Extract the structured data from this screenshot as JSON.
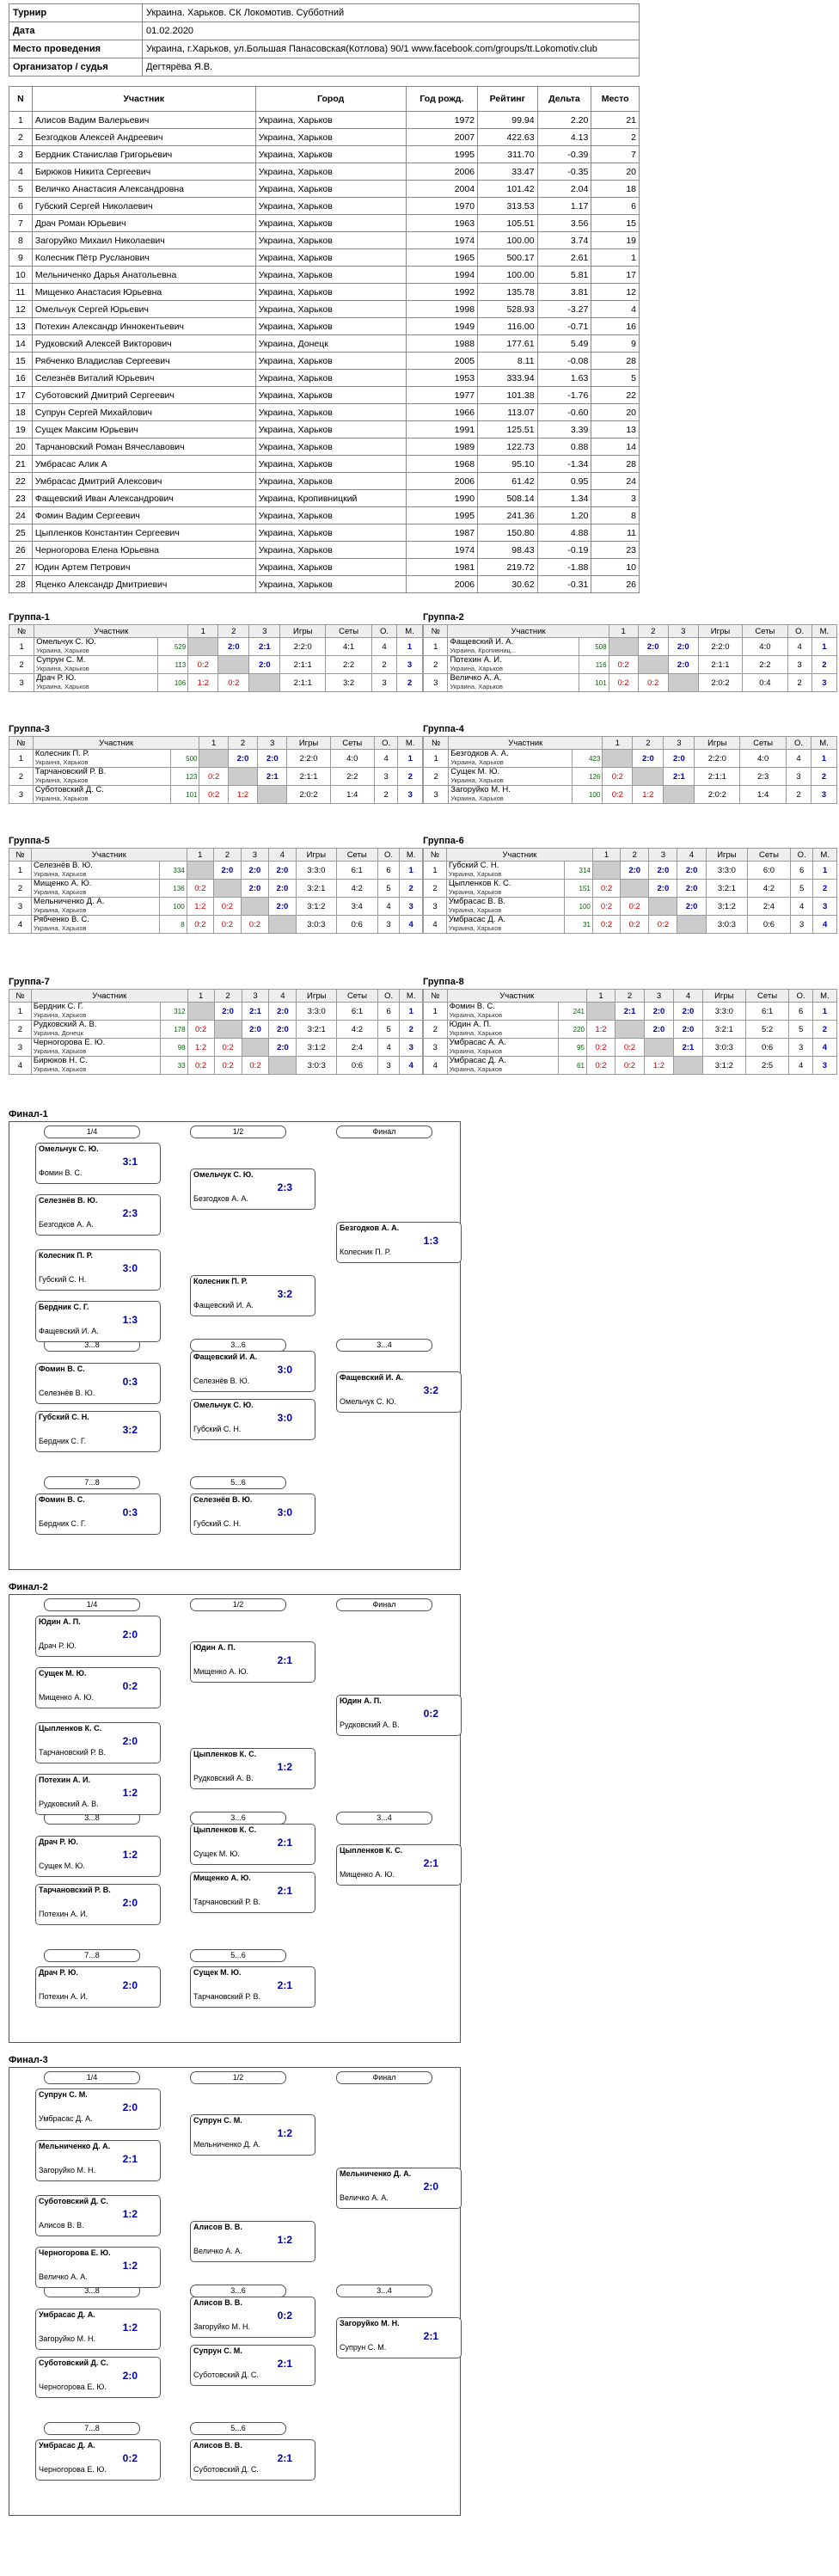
{
  "info": [
    {
      "label": "Турнир",
      "value": "Украина. Харьков. СК Локомотив. Субботний"
    },
    {
      "label": "Дата",
      "value": "01.02.2020"
    },
    {
      "label": "Место проведения",
      "value": "Украина, г.Харьков, ул.Большая Панасовская(Котлова) 90/1 www.facebook.com/groups/tt.Lokomotiv.club"
    },
    {
      "label": "Организатор / судья",
      "value": "Дегтярёва Я.В."
    }
  ],
  "players_header": [
    "N",
    "Участник",
    "Город",
    "Год рожд.",
    "Рейтинг",
    "Дельта",
    "Место"
  ],
  "players": [
    [
      "1",
      "Алисов Вадим Валерьевич",
      "Украина, Харьков",
      "1972",
      "99.94",
      "2.20",
      "21"
    ],
    [
      "2",
      "Безгодков Алексей Андреевич",
      "Украина, Харьков",
      "2007",
      "422.63",
      "4.13",
      "2"
    ],
    [
      "3",
      "Бердник Станислав Григорьевич",
      "Украина, Харьков",
      "1995",
      "311.70",
      "-0.39",
      "7"
    ],
    [
      "4",
      "Бирюков Никита Сергеевич",
      "Украина, Харьков",
      "2006",
      "33.47",
      "-0.35",
      "20"
    ],
    [
      "5",
      "Величко Анастасия Александровна",
      "Украина, Харьков",
      "2004",
      "101.42",
      "2.04",
      "18"
    ],
    [
      "6",
      "Губский Сергей Николаевич",
      "Украина, Харьков",
      "1970",
      "313.53",
      "1.17",
      "6"
    ],
    [
      "7",
      "Драч Роман Юрьевич",
      "Украина, Харьков",
      "1963",
      "105.51",
      "3.56",
      "15"
    ],
    [
      "8",
      "Загоруйко Михаил Николаевич",
      "Украина, Харьков",
      "1974",
      "100.00",
      "3.74",
      "19"
    ],
    [
      "9",
      "Колесник Пётр Русланович",
      "Украина, Харьков",
      "1965",
      "500.17",
      "2.61",
      "1"
    ],
    [
      "10",
      "Мельниченко Дарья Анатольевна",
      "Украина, Харьков",
      "1994",
      "100.00",
      "5.81",
      "17"
    ],
    [
      "11",
      "Мищенко Анастасия Юрьевна",
      "Украина, Харьков",
      "1992",
      "135.78",
      "3.81",
      "12"
    ],
    [
      "12",
      "Омельчук Сергей Юрьевич",
      "Украина, Харьков",
      "1998",
      "528.93",
      "-3.27",
      "4"
    ],
    [
      "13",
      "Потехин Александр Иннокентьевич",
      "Украина, Харьков",
      "1949",
      "116.00",
      "-0.71",
      "16"
    ],
    [
      "14",
      "Рудковский Алексей Викторович",
      "Украина, Донецк",
      "1988",
      "177.61",
      "5.49",
      "9"
    ],
    [
      "15",
      "Рябченко Владислав Сергеевич",
      "Украина, Харьков",
      "2005",
      "8.11",
      "-0.08",
      "28"
    ],
    [
      "16",
      "Селезнёв Виталий Юрьевич",
      "Украина, Харьков",
      "1953",
      "333.94",
      "1.63",
      "5"
    ],
    [
      "17",
      "Суботовский Дмитрий Сергеевич",
      "Украина, Харьков",
      "1977",
      "101.38",
      "-1.76",
      "22"
    ],
    [
      "18",
      "Супрун Сергей Михайлович",
      "Украина, Харьков",
      "1966",
      "113.07",
      "-0.60",
      "20"
    ],
    [
      "19",
      "Сущек Максим Юрьевич",
      "Украина, Харьков",
      "1991",
      "125.51",
      "3.39",
      "13"
    ],
    [
      "20",
      "Тарчановский Роман Вячеславович",
      "Украина, Харьков",
      "1989",
      "122.73",
      "0.88",
      "14"
    ],
    [
      "21",
      "Умбрасас Алик А",
      "Украина, Харьков",
      "1968",
      "95.10",
      "-1.34",
      "28"
    ],
    [
      "22",
      "Умбрасас Дмитрий Алексович",
      "Украина, Харьков",
      "2006",
      "61.42",
      "0.95",
      "24"
    ],
    [
      "23",
      "Фащевский Иван Александрович",
      "Украина, Кропивницкий",
      "1990",
      "508.14",
      "1.34",
      "3"
    ],
    [
      "24",
      "Фомин Вадим Сергеевич",
      "Украина, Харьков",
      "1995",
      "241.36",
      "1.20",
      "8"
    ],
    [
      "25",
      "Цыпленков Константин Сергеевич",
      "Украина, Харьков",
      "1987",
      "150.80",
      "4.88",
      "11"
    ],
    [
      "26",
      "Черногорова Елена Юрьевна",
      "Украина, Харьков",
      "1974",
      "98.43",
      "-0.19",
      "23"
    ],
    [
      "27",
      "Юдин Артем Петрович",
      "Украина, Харьков",
      "1981",
      "219.72",
      "-1.88",
      "10"
    ],
    [
      "28",
      "Яценко Александр Дмитриевич",
      "Украина, Харьков",
      "2006",
      "30.62",
      "-0.31",
      "26"
    ]
  ],
  "groups": [
    {
      "title": "Группа-1",
      "rows": [
        [
          "1",
          "Омельчук С. Ю.",
          "Украина, Харьков",
          "529",
          "",
          "2:0",
          "2:1",
          "2:2:0",
          "4:1",
          "4",
          "1"
        ],
        [
          "2",
          "Супрун С. М.",
          "Украина, Харьков",
          "113",
          "0:2",
          "",
          "2:0",
          "2:1:1",
          "2:2",
          "2",
          "3"
        ],
        [
          "3",
          "Драч Р. Ю.",
          "Украина, Харьков",
          "106",
          "1:2",
          "0:2",
          "",
          "2:1:1",
          "3:2",
          "3",
          "2"
        ]
      ]
    },
    {
      "title": "Группа-2",
      "rows": [
        [
          "1",
          "Фащевский И. А.",
          "Украина, Кропивниц...",
          "508",
          "",
          "2:0",
          "2:0",
          "2:2:0",
          "4:0",
          "4",
          "1"
        ],
        [
          "2",
          "Потехин А. И.",
          "Украина, Харьков",
          "116",
          "0:2",
          "",
          "2:0",
          "2:1:1",
          "2:2",
          "3",
          "2"
        ],
        [
          "3",
          "Величко А. А.",
          "Украина, Харьков",
          "101",
          "0:2",
          "0:2",
          "",
          "2:0:2",
          "0:4",
          "2",
          "3"
        ]
      ]
    },
    {
      "title": "Группа-3",
      "rows": [
        [
          "1",
          "Колесник П. Р.",
          "Украина, Харьков",
          "500",
          "",
          "2:0",
          "2:0",
          "2:2:0",
          "4:0",
          "4",
          "1"
        ],
        [
          "2",
          "Тарчановский Р. В.",
          "Украина, Харьков",
          "123",
          "0:2",
          "",
          "2:1",
          "2:1:1",
          "2:2",
          "3",
          "2"
        ],
        [
          "3",
          "Суботовский Д. С.",
          "Украина, Харьков",
          "101",
          "0:2",
          "1:2",
          "",
          "2:0:2",
          "1:4",
          "2",
          "3"
        ]
      ]
    },
    {
      "title": "Группа-4",
      "rows": [
        [
          "1",
          "Безгодков А. А.",
          "Украина, Харьков",
          "423",
          "",
          "2:0",
          "2:0",
          "2:2:0",
          "4:0",
          "4",
          "1"
        ],
        [
          "2",
          "Сущек М. Ю.",
          "Украина, Харьков",
          "126",
          "0:2",
          "",
          "2:1",
          "2:1:1",
          "2:3",
          "3",
          "2"
        ],
        [
          "3",
          "Загоруйко М. Н.",
          "Украина, Харьков",
          "100",
          "0:2",
          "1:2",
          "",
          "2:0:2",
          "1:4",
          "2",
          "3"
        ]
      ]
    },
    {
      "title": "Группа-5",
      "rows": [
        [
          "1",
          "Селезнёв В. Ю.",
          "Украина, Харьков",
          "334",
          "",
          "2:0",
          "2:0",
          "2:0",
          "3:3:0",
          "6:1",
          "6",
          "1"
        ],
        [
          "2",
          "Мищенко А. Ю.",
          "Украина, Харьков",
          "136",
          "0:2",
          "",
          "2:0",
          "2:0",
          "3:2:1",
          "4:2",
          "5",
          "2"
        ],
        [
          "3",
          "Мельниченко Д. А.",
          "Украина, Харьков",
          "100",
          "1:2",
          "0:2",
          "",
          "2:0",
          "3:1:2",
          "3:4",
          "4",
          "3"
        ],
        [
          "4",
          "Рябченко В. С.",
          "Украина, Харьков",
          "8",
          "0:2",
          "0:2",
          "0:2",
          "",
          "3:0:3",
          "0:6",
          "3",
          "4"
        ]
      ]
    },
    {
      "title": "Группа-6",
      "rows": [
        [
          "1",
          "Губский С. Н.",
          "Украина, Харьков",
          "314",
          "",
          "2:0",
          "2:0",
          "2:0",
          "3:3:0",
          "6:0",
          "6",
          "1"
        ],
        [
          "2",
          "Цыпленков К. С.",
          "Украина, Харьков",
          "151",
          "0:2",
          "",
          "2:0",
          "2:0",
          "3:2:1",
          "4:2",
          "5",
          "2"
        ],
        [
          "3",
          "Умбрасас В. В.",
          "Украина, Харьков",
          "100",
          "0:2",
          "0:2",
          "",
          "2:0",
          "3:1:2",
          "2:4",
          "4",
          "3"
        ],
        [
          "4",
          "Умбрасас Д. А.",
          "Украина, Харьков",
          "31",
          "0:2",
          "0:2",
          "0:2",
          "",
          "3:0:3",
          "0:6",
          "3",
          "4"
        ]
      ]
    },
    {
      "title": "Группа-7",
      "rows": [
        [
          "1",
          "Бердник С. Г.",
          "Украина, Харьков",
          "312",
          "",
          "2:0",
          "2:1",
          "2:0",
          "3:3:0",
          "6:1",
          "6",
          "1"
        ],
        [
          "2",
          "Рудковский А. В.",
          "Украина, Донецк",
          "178",
          "0:2",
          "",
          "2:0",
          "2:0",
          "3:2:1",
          "4:2",
          "5",
          "2"
        ],
        [
          "3",
          "Черногорова Е. Ю.",
          "Украина, Харьков",
          "98",
          "1:2",
          "0:2",
          "",
          "2:0",
          "3:1:2",
          "2:4",
          "4",
          "3"
        ],
        [
          "4",
          "Бирюков Н. С.",
          "Украина, Харьков",
          "33",
          "0:2",
          "0:2",
          "0:2",
          "",
          "3:0:3",
          "0:6",
          "3",
          "4"
        ]
      ]
    },
    {
      "title": "Группа-8",
      "rows": [
        [
          "1",
          "Фомин В. С.",
          "Украина, Харьков",
          "241",
          "",
          "2:1",
          "2:0",
          "2:0",
          "3:3:0",
          "6:1",
          "6",
          "1"
        ],
        [
          "2",
          "Юдин А. П.",
          "Украина, Харьков",
          "220",
          "1:2",
          "",
          "2:0",
          "2:0",
          "3:2:1",
          "5:2",
          "5",
          "2"
        ],
        [
          "3",
          "Умбрасас А. А.",
          "Украина, Харьков",
          "95",
          "0:2",
          "0:2",
          "",
          "2:1",
          "3:0:3",
          "0:6",
          "3",
          "4"
        ],
        [
          "4",
          "Умбрасас Д. А.",
          "Украина, Харьков",
          "61",
          "0:2",
          "0:2",
          "1:2",
          "",
          "3:1:2",
          "2:5",
          "4",
          "3"
        ]
      ]
    }
  ],
  "group_head3": [
    "№",
    "Участник",
    "1",
    "2",
    "3",
    "Игры",
    "Сеты",
    "О.",
    "М."
  ],
  "group_head4": [
    "№",
    "Участник",
    "1",
    "2",
    "3",
    "4",
    "Игры",
    "Сеты",
    "О.",
    "М."
  ],
  "finals": [
    {
      "title": "Финал-1",
      "rounds": [
        "1/4",
        "1/2",
        "Финал"
      ],
      "r2": [
        "3...8",
        "3...6",
        "3...4"
      ],
      "r3": [
        "7...8",
        "5...6"
      ],
      "m": [
        [
          "Омельчук С. Ю.",
          "Фомин В. С.",
          "3:1"
        ],
        [
          "Селезнёв В. Ю.",
          "Безгодков А. А.",
          "2:3"
        ],
        [
          "Колесник П. Р.",
          "Губский С. Н.",
          "3:0"
        ],
        [
          "Бердник С. Г.",
          "Фащевский И. А.",
          "1:3"
        ],
        [
          "Омельчук С. Ю.",
          "Безгодков А. А.",
          "2:3"
        ],
        [
          "Колесник П. Р.",
          "Фащевский И. А.",
          "3:2"
        ],
        [
          "Безгодков А. А.",
          "Колесник П. Р.",
          "1:3"
        ],
        [
          "Фомин В. С.",
          "Селезнёв В. Ю.",
          "0:3"
        ],
        [
          "Губский С. Н.",
          "Бердник С. Г.",
          "3:2"
        ],
        [
          "Фащевский И. А.",
          "Селезнёв В. Ю.",
          "3:0"
        ],
        [
          "Омельчук С. Ю.",
          "Губский С. Н.",
          "3:0"
        ],
        [
          "Фащевский И. А.",
          "Омельчук С. Ю.",
          "3:2"
        ],
        [
          "Фомин В. С.",
          "Бердник С. Г.",
          "0:3"
        ],
        [
          "Селезнёв В. Ю.",
          "Губский С. Н.",
          "3:0"
        ]
      ]
    },
    {
      "title": "Финал-2",
      "rounds": [
        "1/4",
        "1/2",
        "Финал"
      ],
      "r2": [
        "3...8",
        "3...6",
        "3...4"
      ],
      "r3": [
        "7...8",
        "5...6"
      ],
      "m": [
        [
          "Юдин А. П.",
          "Драч Р. Ю.",
          "2:0"
        ],
        [
          "Сущек М. Ю.",
          "Мищенко А. Ю.",
          "0:2"
        ],
        [
          "Цыпленков К. С.",
          "Тарчановский Р. В.",
          "2:0"
        ],
        [
          "Потехин А. И.",
          "Рудковский А. В.",
          "1:2"
        ],
        [
          "Юдин А. П.",
          "Мищенко А. Ю.",
          "2:1"
        ],
        [
          "Цыпленков К. С.",
          "Рудковский А. В.",
          "1:2"
        ],
        [
          "Юдин А. П.",
          "Рудковский А. В.",
          "0:2"
        ],
        [
          "Драч Р. Ю.",
          "Сущек М. Ю.",
          "1:2"
        ],
        [
          "Тарчановский Р. В.",
          "Потехин А. И.",
          "2:0"
        ],
        [
          "Цыпленков К. С.",
          "Сущек М. Ю.",
          "2:1"
        ],
        [
          "Мищенко А. Ю.",
          "Тарчановский Р. В.",
          "2:1"
        ],
        [
          "Цыпленков К. С.",
          "Мищенко А. Ю.",
          "2:1"
        ],
        [
          "Драч Р. Ю.",
          "Потехин А. И.",
          "2:0"
        ],
        [
          "Сущек М. Ю.",
          "Тарчановский Р. В.",
          "2:1"
        ]
      ]
    },
    {
      "title": "Финал-3",
      "rounds": [
        "1/4",
        "1/2",
        "Финал"
      ],
      "r2": [
        "3...8",
        "3...6",
        "3...4"
      ],
      "r3": [
        "7...8",
        "5...6"
      ],
      "m": [
        [
          "Супрун С. М.",
          "Умбрасас Д. А.",
          "2:0"
        ],
        [
          "Мельниченко Д. А.",
          "Загоруйко М. Н.",
          "2:1"
        ],
        [
          "Суботовский Д. С.",
          "Алисов В. В.",
          "1:2"
        ],
        [
          "Черногорова Е. Ю.",
          "Величко А. А.",
          "1:2"
        ],
        [
          "Супрун С. М.",
          "Мельниченко Д. А.",
          "1:2"
        ],
        [
          "Алисов В. В.",
          "Величко А. А.",
          "1:2"
        ],
        [
          "Мельниченко Д. А.",
          "Величко А. А.",
          "2:0"
        ],
        [
          "Умбрасас Д. А.",
          "Загоруйко М. Н.",
          "1:2"
        ],
        [
          "Суботовский Д. С.",
          "Черногорова Е. Ю.",
          "2:0"
        ],
        [
          "Алисов В. В.",
          "Загоруйко М. Н.",
          "0:2"
        ],
        [
          "Супрун С. М.",
          "Суботовский Д. С.",
          "2:1"
        ],
        [
          "Загоруйко М. Н.",
          "Супрун С. М.",
          "2:1"
        ],
        [
          "Умбрасас Д. А.",
          "Черногорова Е. Ю.",
          "0:2"
        ],
        [
          "Алисов В. В.",
          "Суботовский Д. С.",
          "2:1"
        ]
      ]
    }
  ]
}
